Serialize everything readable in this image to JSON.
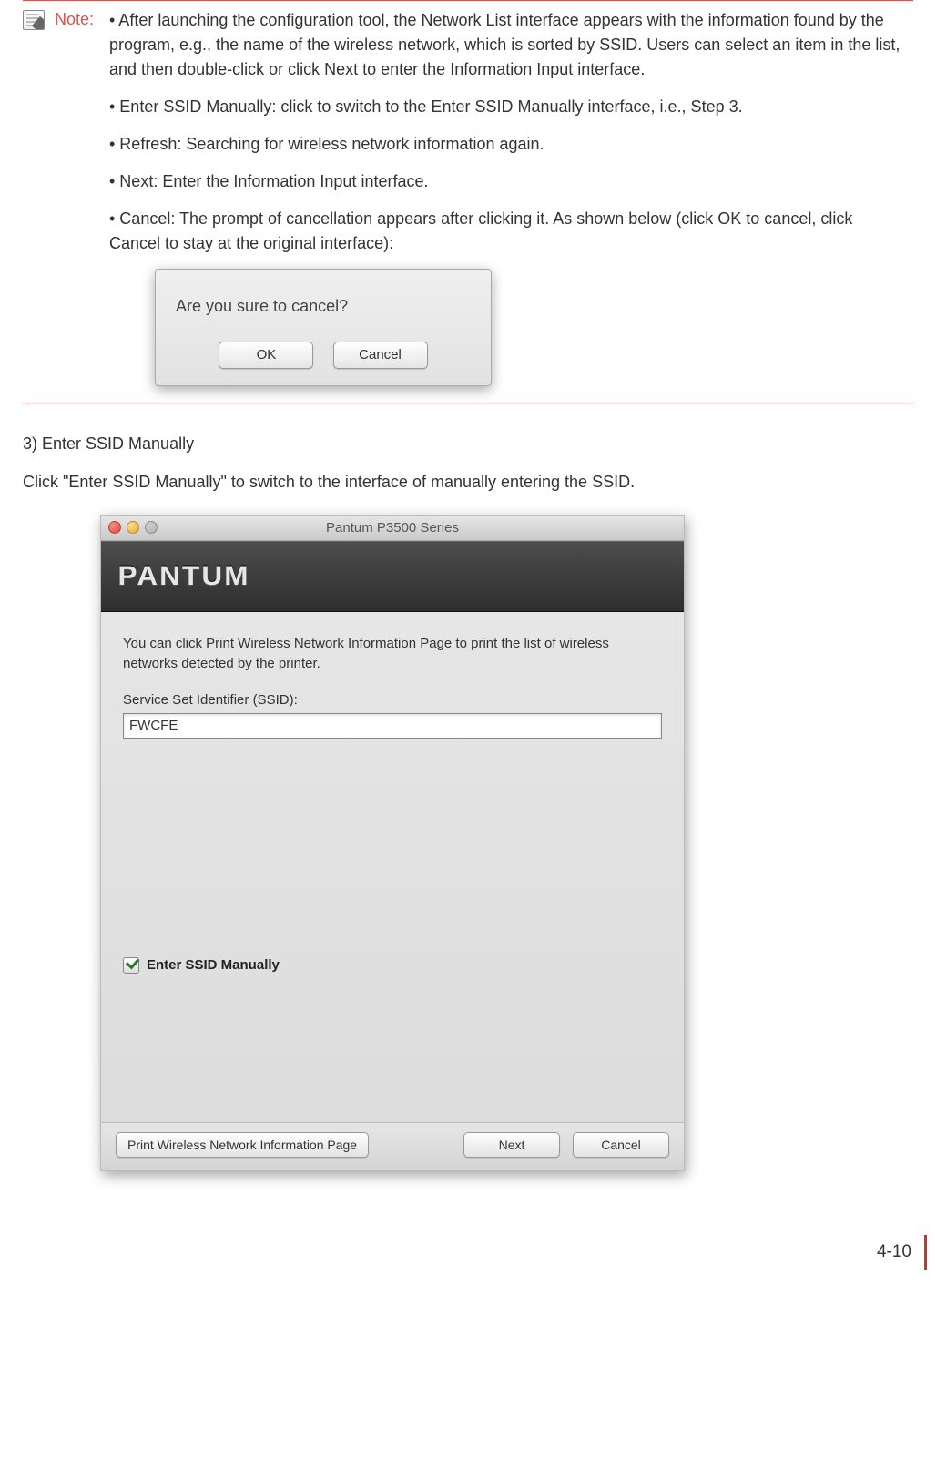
{
  "note": {
    "label": "Note:",
    "bullets": [
      "• After launching the configuration tool, the Network List interface appears with the information found by the program, e.g., the name of the wireless network, which is sorted by SSID. Users can select an item in the list, and then double-click or click Next to enter the Information Input interface.",
      "• Enter SSID Manually: click to switch to the Enter SSID Manually interface, i.e., Step 3.",
      "• Refresh: Searching for wireless network information again.",
      "• Next: Enter the Information Input interface.",
      "• Cancel: The prompt of cancellation appears after clicking it. As shown below (click OK to cancel, click Cancel to stay at the original interface):"
    ]
  },
  "confirm_dialog": {
    "message": "Are you sure to cancel?",
    "ok_label": "OK",
    "cancel_label": "Cancel"
  },
  "section": {
    "heading": "3) Enter SSID Manually",
    "description": "Click \"Enter SSID Manually\" to switch to the interface of manually entering the SSID."
  },
  "window": {
    "title": "Pantum P3500 Series",
    "brand": "PANTUM",
    "instructions": "You can click Print Wireless Network Information Page to print the list of wireless networks detected by the printer.",
    "field_label": "Service Set Identifier (SSID):",
    "ssid_value": "FWCFE",
    "checkbox_label": "Enter SSID Manually",
    "print_button": "Print Wireless Network Information Page",
    "next_button": "Next",
    "cancel_button": "Cancel"
  },
  "page_number": "4-10"
}
